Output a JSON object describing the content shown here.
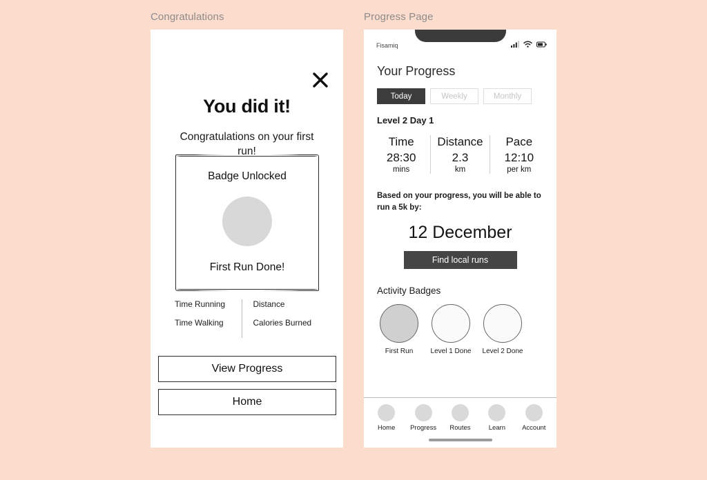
{
  "background_color": "#fbdccd",
  "panels": {
    "left_caption": "Congratulations",
    "right_caption": "Progress Page"
  },
  "congrats_screen": {
    "close_icon": "close-icon",
    "heading": "You did it!",
    "subheading": "Congratulations on your first run!",
    "badge_card": {
      "title": "Badge Unlocked",
      "badge_icon": "badge-circle-icon",
      "caption": "First Run Done!"
    },
    "stats": {
      "left_column": [
        "Time Running",
        "Time Walking"
      ],
      "right_column": [
        "Distance",
        "Calories Burned"
      ]
    },
    "buttons": [
      {
        "label": "View Progress",
        "name": "view-progress-button"
      },
      {
        "label": "Home",
        "name": "home-button"
      }
    ]
  },
  "progress_screen": {
    "status_bar": {
      "carrier": "Fisamiq",
      "icons": [
        "signal-icon",
        "wifi-icon",
        "battery-icon"
      ]
    },
    "title": "Your Progress",
    "tabs": [
      {
        "label": "Today",
        "active": true
      },
      {
        "label": "Weekly",
        "active": false
      },
      {
        "label": "Monthly",
        "active": false
      }
    ],
    "level_day": "Level 2 Day 1",
    "metrics": [
      {
        "label": "Time",
        "value": "28:30",
        "unit": "mins"
      },
      {
        "label": "Distance",
        "value": "2.3",
        "unit": "km"
      },
      {
        "label": "Pace",
        "value": "12:10",
        "unit": "per km"
      }
    ],
    "forecast_text": "Based on your progress, you will be able to run a 5k by:",
    "forecast_date": "12 December",
    "find_runs_label": "Find local runs",
    "badges_title": "Activity Badges",
    "badges": [
      {
        "name": "First Run",
        "earned": true
      },
      {
        "name": "Level 1 Done",
        "earned": false
      },
      {
        "name": "Level 2 Done",
        "earned": false
      }
    ],
    "nav_items": [
      {
        "label": "Home"
      },
      {
        "label": "Progress"
      },
      {
        "label": "Routes"
      },
      {
        "label": "Learn"
      },
      {
        "label": "Account"
      }
    ]
  },
  "colors": {
    "accent_dark": "#3d3c3c",
    "button_dark": "#454545",
    "badge_fill": "#d0d0d0"
  }
}
